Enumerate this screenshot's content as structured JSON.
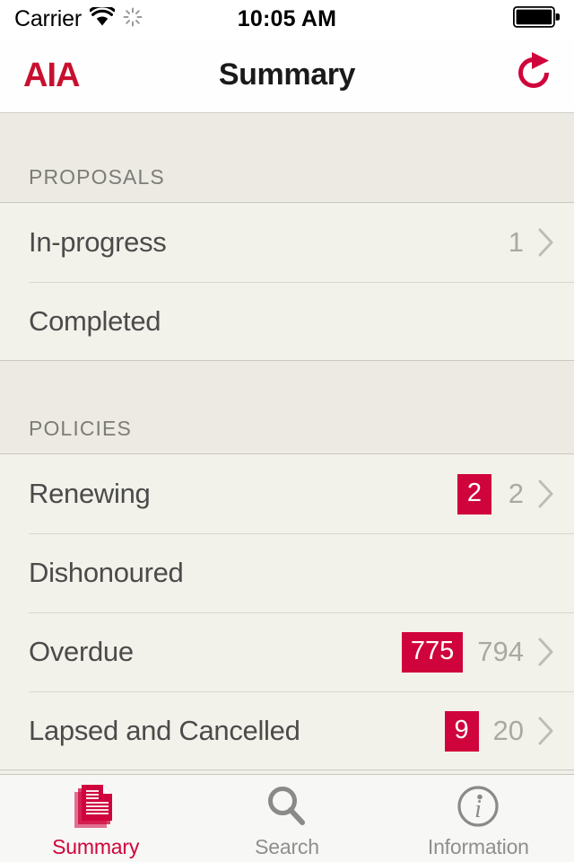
{
  "status_bar": {
    "carrier": "Carrier",
    "wifi_icon": "wifi-icon",
    "activity_icon": "network-activity-spinner-icon",
    "time": "10:05 AM",
    "battery_icon": "battery-full-icon"
  },
  "nav_bar": {
    "brand": "AIA",
    "title": "Summary",
    "refresh_icon": "refresh-icon"
  },
  "theme": {
    "accent": "#d0043c",
    "brand_red": "#c8102e",
    "page_bg": "#f1f0e8",
    "row_bg": "#f3f2ea",
    "header_bg": "#eceae2",
    "label_text": "#4b4b4b",
    "muted_text": "#a9a9a4",
    "tab_inactive": "#8e8e8e"
  },
  "sections": [
    {
      "header": "PROPOSALS",
      "rows": [
        {
          "label": "In-progress",
          "badge": "",
          "count": "1",
          "chevron": true
        },
        {
          "label": "Completed",
          "badge": "",
          "count": "",
          "chevron": false
        }
      ]
    },
    {
      "header": "POLICIES",
      "rows": [
        {
          "label": "Renewing",
          "badge": "2",
          "count": "2",
          "chevron": true
        },
        {
          "label": "Dishonoured",
          "badge": "",
          "count": "",
          "chevron": false
        },
        {
          "label": "Overdue",
          "badge": "775",
          "count": "794",
          "chevron": true
        },
        {
          "label": "Lapsed and Cancelled",
          "badge": "9",
          "count": "20",
          "chevron": true
        }
      ]
    }
  ],
  "tab_bar": {
    "items": [
      {
        "label": "Summary",
        "icon": "document-stack-icon",
        "active": true
      },
      {
        "label": "Search",
        "icon": "search-icon",
        "active": false
      },
      {
        "label": "Information",
        "icon": "info-circle-icon",
        "active": false
      }
    ]
  }
}
